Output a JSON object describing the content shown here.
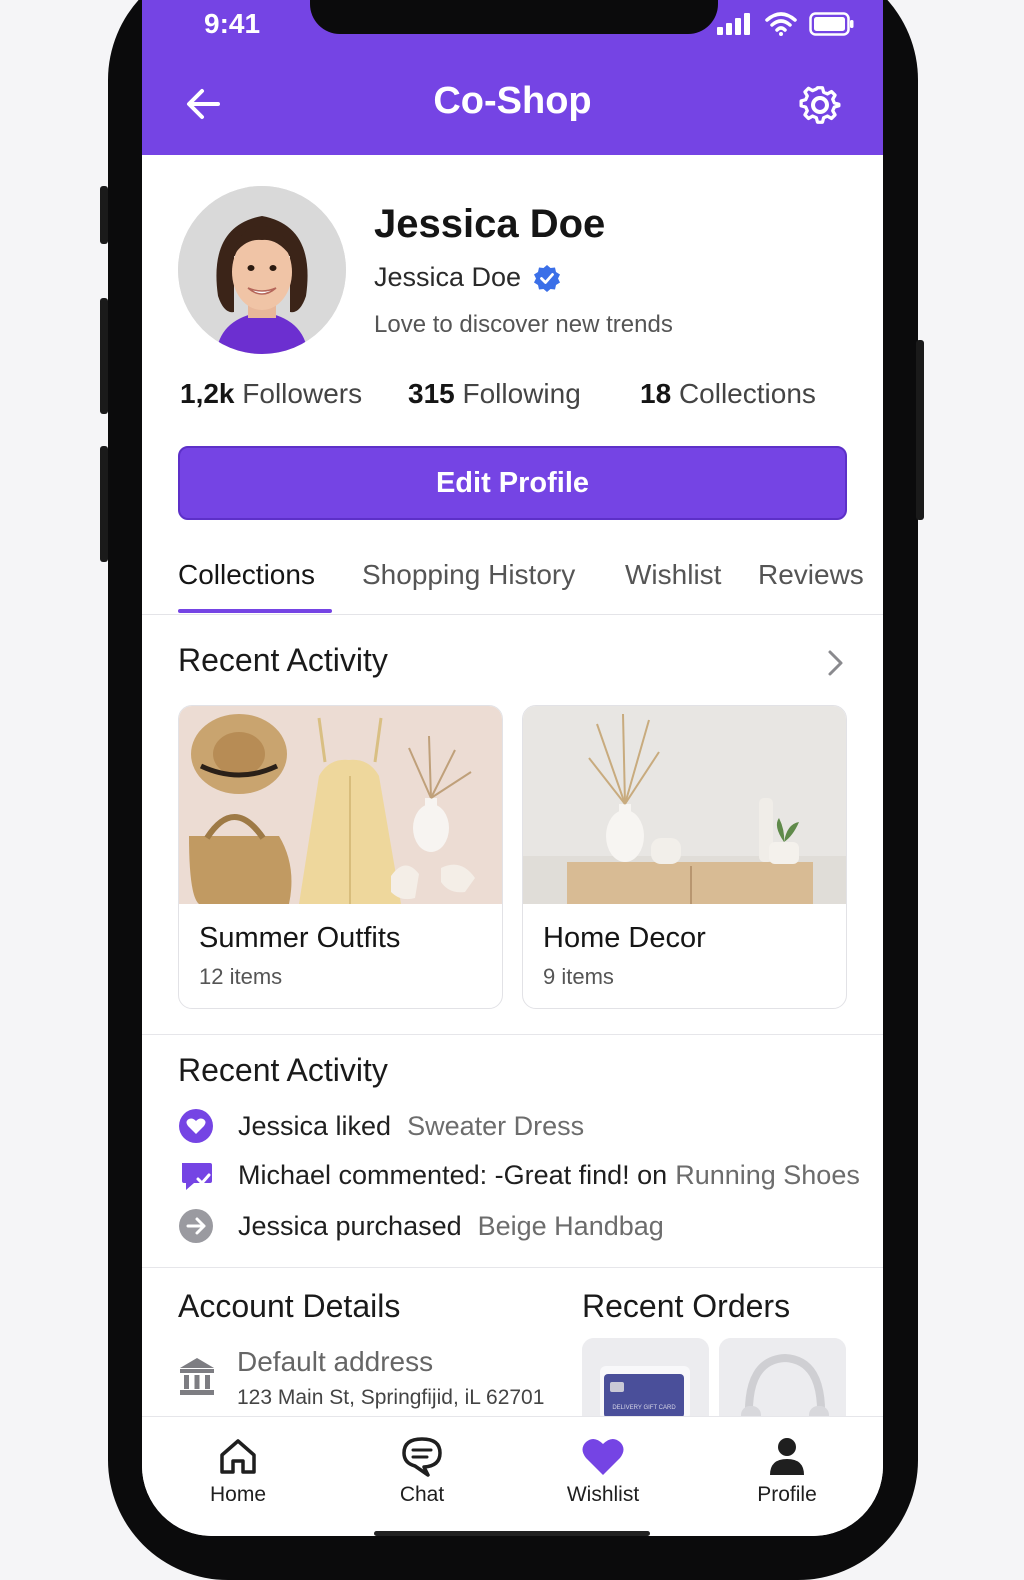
{
  "status_bar": {
    "time": "9:41"
  },
  "header": {
    "title": "Co-Shop"
  },
  "profile": {
    "display_name": "Jessica Doe",
    "username": "Jessica Doe",
    "verified": true,
    "bio": "Love to discover new trends"
  },
  "stats": [
    {
      "value": "1,2k",
      "label": "Followers"
    },
    {
      "value": "315",
      "label": "Following"
    },
    {
      "value": "18",
      "label": "Collections"
    }
  ],
  "edit_button": "Edit Profile",
  "tabs": [
    {
      "label": "Collections",
      "active": true
    },
    {
      "label": "Shopping History",
      "active": false
    },
    {
      "label": "Wishlist",
      "active": false
    },
    {
      "label": "Reviews",
      "active": false
    }
  ],
  "collections_section": {
    "title": "Recent Activity",
    "cards": [
      {
        "title": "Summer Outfits",
        "count": "12 items"
      },
      {
        "title": "Home Decor",
        "count": "9 items"
      }
    ]
  },
  "activity_section": {
    "title": "Recent Activity",
    "items": [
      {
        "icon": "heart-icon",
        "text": "Jessica liked",
        "link": "Sweater Dress"
      },
      {
        "icon": "comment-icon",
        "text": "Michael commented: -Great find! on",
        "link": "Running  Shoes"
      },
      {
        "icon": "arrow-right-circle-icon",
        "text": "Jessica purchased",
        "link": "Beige Handbag"
      }
    ]
  },
  "account_details": {
    "title": "Account Details",
    "address_label": "Default address",
    "address_value": "123 Main St, Springfijid, iL 62701"
  },
  "recent_orders": {
    "title": "Recent Orders",
    "card_text": "DELIVERY GIFT CARD"
  },
  "bottom_nav": [
    {
      "label": "Home",
      "icon": "home-icon",
      "active": false
    },
    {
      "label": "Chat",
      "icon": "chat-icon",
      "active": false
    },
    {
      "label": "Wishlist",
      "icon": "heart-icon",
      "active": true
    },
    {
      "label": "Profile",
      "icon": "person-icon",
      "active": false
    }
  ],
  "colors": {
    "accent": "#7544e4",
    "verified": "#3b6fe8"
  }
}
